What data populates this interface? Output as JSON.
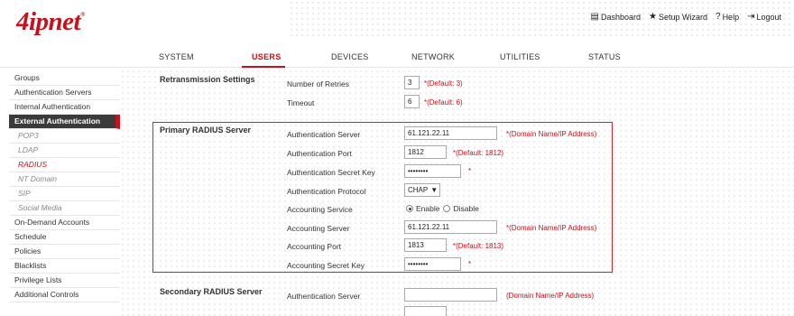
{
  "header": {
    "logo_text": "4ipnet",
    "logo_mark": "®",
    "links": [
      {
        "icon": "dashboard-icon",
        "label": "Dashboard"
      },
      {
        "icon": "setup-wizard-icon",
        "label": "Setup Wizard"
      },
      {
        "icon": "help-icon",
        "label": "Help"
      },
      {
        "icon": "logout-icon",
        "label": "Logout"
      }
    ]
  },
  "nav": {
    "items": [
      "SYSTEM",
      "USERS",
      "DEVICES",
      "NETWORK",
      "UTILITIES",
      "STATUS"
    ],
    "active": "USERS"
  },
  "sidebar": {
    "items": [
      "Groups",
      "Authentication Servers",
      "Internal Authentication",
      "External Authentication",
      "POP3",
      "LDAP",
      "RADIUS",
      "NT Domain",
      "SIP",
      "Social Media",
      "On-Demand Accounts",
      "Schedule",
      "Policies",
      "Blacklists",
      "Privilege Lists",
      "Additional Controls"
    ]
  },
  "retransmission": {
    "title": "Retransmission Settings",
    "retries_label": "Number of Retries",
    "retries_value": "3",
    "retries_hint": "*(Default: 3)",
    "timeout_label": "Timeout",
    "timeout_value": "6",
    "timeout_hint": "*(Default: 6)"
  },
  "primary": {
    "title": "Primary RADIUS Server",
    "auth_server_label": "Authentication Server",
    "auth_server_value": "61.121.22.11",
    "auth_server_hint": "*(Domain Name/IP Address)",
    "auth_port_label": "Authentication Port",
    "auth_port_value": "1812",
    "auth_port_hint": "*(Default: 1812)",
    "secret_label": "Authentication Secret Key",
    "secret_value": "••••••••",
    "secret_hint": "*",
    "protocol_label": "Authentication Protocol",
    "protocol_value": "CHAP",
    "acct_service_label": "Accounting Service",
    "acct_enable": "Enable",
    "acct_disable": "Disable",
    "acct_server_label": "Accounting Server",
    "acct_server_value": "61.121.22.11",
    "acct_server_hint": "*(Domain Name/IP Address)",
    "acct_port_label": "Accounting Port",
    "acct_port_value": "1813",
    "acct_port_hint": "*(Default: 1813)",
    "acct_secret_label": "Accounting Secret Key",
    "acct_secret_value": "••••••••",
    "acct_secret_hint": "*"
  },
  "secondary": {
    "title": "Secondary RADIUS Server",
    "auth_server_label": "Authentication Server",
    "auth_server_value": "",
    "auth_server_hint": "(Domain Name/IP Address)"
  },
  "colors": {
    "accent": "#c8101a",
    "sidebar_active": "#3a3a3a"
  }
}
